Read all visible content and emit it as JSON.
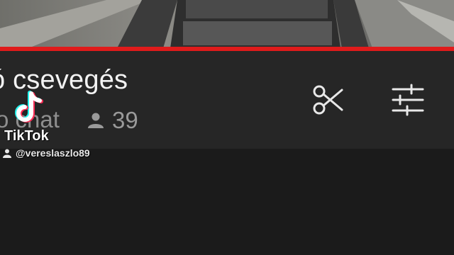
{
  "chat": {
    "title": "ó csevegés",
    "subtitle": "o chat",
    "viewer_count": "39"
  },
  "icons": {
    "viewers": "person-icon",
    "clip": "scissors-icon",
    "filters": "sliders-icon"
  },
  "watermark": {
    "brand": "TikTok",
    "username": "@vereslaszlo89"
  },
  "colors": {
    "accent_red": "#e01b1b",
    "panel": "#262626",
    "background": "#1b1b1b"
  }
}
